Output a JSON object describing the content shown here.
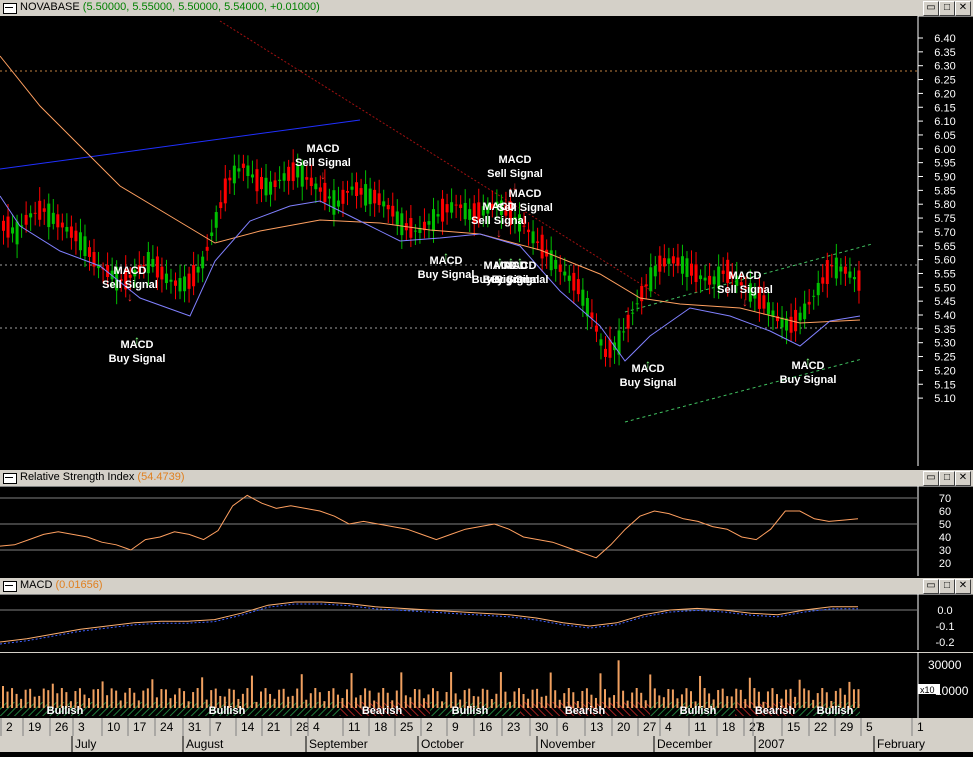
{
  "main_panel": {
    "symbol": "NOVABASE",
    "ohlc_text": "(5.50000, 5.55000, 5.50000, 5.54000, +0.01000)",
    "price_ticks": [
      "6.40",
      "6.35",
      "6.30",
      "6.25",
      "6.20",
      "6.15",
      "6.10",
      "6.05",
      "6.00",
      "5.95",
      "5.90",
      "5.85",
      "5.80",
      "5.75",
      "5.70",
      "5.65",
      "5.60",
      "5.55",
      "5.50",
      "5.45",
      "5.40",
      "5.35",
      "5.30",
      "5.25",
      "5.20",
      "5.15",
      "5.10"
    ],
    "annotations": [
      {
        "line1": "MACD",
        "line2": "Sell Signal"
      },
      {
        "line1": "MACD",
        "line2": "Buy Signal"
      },
      {
        "line1": "MACD",
        "line2": "Sell Signal"
      },
      {
        "line1": "MACD",
        "line2": "Buy Signal"
      },
      {
        "line1": "MACD",
        "line2": "Sell Signal"
      },
      {
        "line1": "MACD",
        "line2": "Sell Signal"
      },
      {
        "line1": "MACD",
        "line2": "Sell Signal"
      },
      {
        "line1": "MACD",
        "line2": "Buy Signal"
      },
      {
        "line1": "MACD",
        "line2": "Buy Signal"
      },
      {
        "line1": "MACD",
        "line2": "Buy Signal"
      },
      {
        "line1": "MACD",
        "line2": "Buy Signal"
      },
      {
        "line1": "MACD",
        "line2": "Sell Signal"
      },
      {
        "line1": "MACD",
        "line2": "Buy Signal"
      }
    ]
  },
  "rsi_panel": {
    "title": "Relative Strength Index",
    "value": "(54.4739)",
    "ticks": [
      "70",
      "60",
      "50",
      "40",
      "30",
      "20"
    ]
  },
  "macd_panel": {
    "title": "MACD",
    "value": "(0.01656)",
    "ticks": [
      "0.0",
      "-0.1",
      "-0.2"
    ]
  },
  "volume_panel": {
    "ticks": [
      "30000",
      "10000"
    ],
    "multiplier": "x10",
    "trend_labels": [
      "Bullish",
      "Bullish",
      "Bearish",
      "Bullish",
      "Bearish",
      "Bullish",
      "Bearish",
      "Bullish"
    ]
  },
  "date_axis": {
    "days": [
      "2",
      "19",
      "26",
      "3",
      "10",
      "17",
      "24",
      "31",
      "7",
      "14",
      "21",
      "28",
      "4",
      "11",
      "18",
      "25",
      "2",
      "9",
      "16",
      "23",
      "30",
      "6",
      "13",
      "20",
      "27",
      "4",
      "11",
      "18",
      "27",
      "8",
      "15",
      "22",
      "29",
      "5",
      "1"
    ],
    "months": [
      "July",
      "August",
      "September",
      "October",
      "November",
      "December",
      "2007",
      "February"
    ]
  },
  "colors": {
    "up_candle": "#00c000",
    "down_candle": "#ff0000",
    "ma_fast": "#8080ff",
    "ma_slow": "#ffa060",
    "title_bg": "#d4d0c8",
    "macd_line": "#ffb070"
  },
  "window_buttons": [
    "minimize-icon",
    "restore-icon",
    "close-icon"
  ]
}
